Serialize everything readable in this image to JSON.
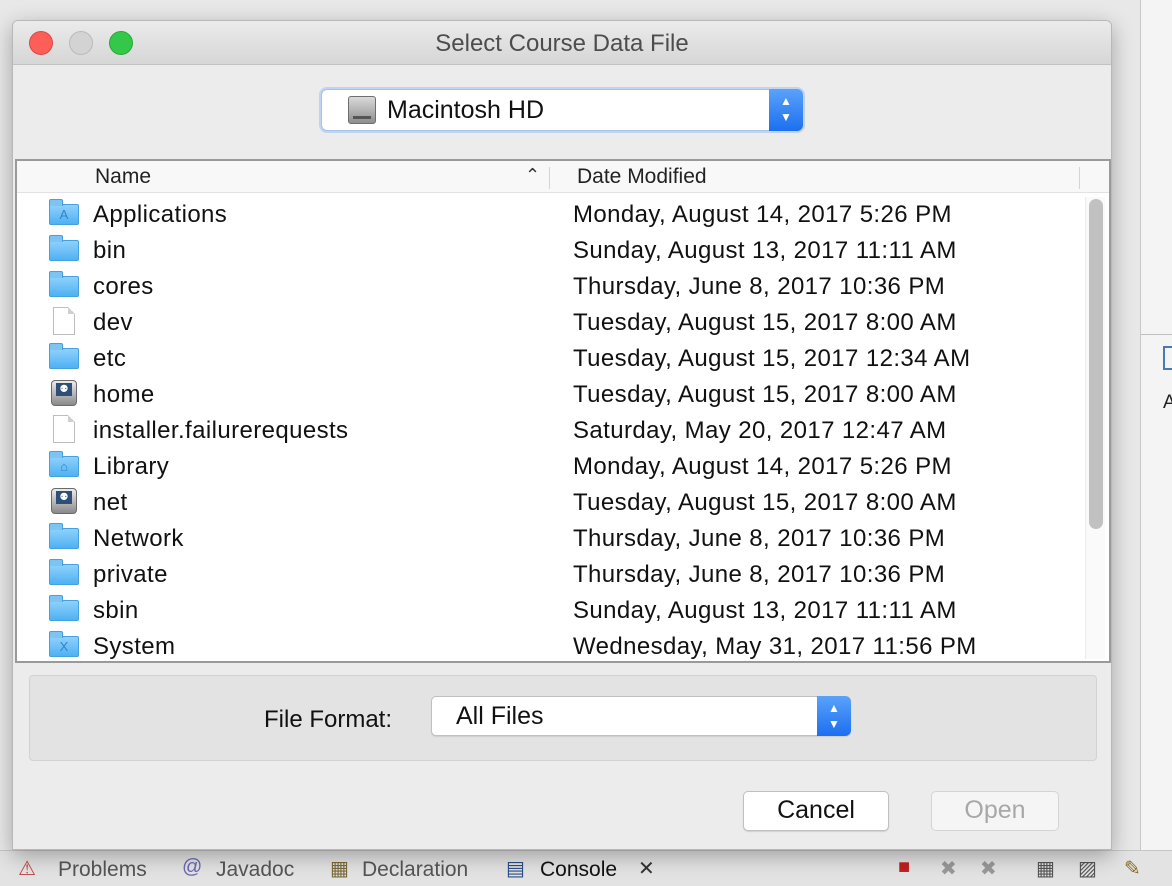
{
  "dialog": {
    "title": "Select Course Data File",
    "location": "Macintosh HD",
    "columns": {
      "name": "Name",
      "date": "Date Modified"
    },
    "files": [
      {
        "name": "Applications",
        "date": "Monday, August 14, 2017 5:26 PM",
        "icon": "applications-folder-icon"
      },
      {
        "name": "bin",
        "date": "Sunday, August 13, 2017 11:11 AM",
        "icon": "folder-icon"
      },
      {
        "name": "cores",
        "date": "Thursday, June 8, 2017 10:36 PM",
        "icon": "folder-icon"
      },
      {
        "name": "dev",
        "date": "Tuesday, August 15, 2017 8:00 AM",
        "icon": "document-icon"
      },
      {
        "name": "etc",
        "date": "Tuesday, August 15, 2017 12:34 AM",
        "icon": "folder-icon"
      },
      {
        "name": "home",
        "date": "Tuesday, August 15, 2017 8:00 AM",
        "icon": "server-icon"
      },
      {
        "name": "installer.failurerequests",
        "date": "Saturday, May 20, 2017 12:47 AM",
        "icon": "document-icon"
      },
      {
        "name": "Library",
        "date": "Monday, August 14, 2017 5:26 PM",
        "icon": "library-folder-icon"
      },
      {
        "name": "net",
        "date": "Tuesday, August 15, 2017 8:00 AM",
        "icon": "server-icon"
      },
      {
        "name": "Network",
        "date": "Thursday, June 8, 2017 10:36 PM",
        "icon": "folder-icon"
      },
      {
        "name": "private",
        "date": "Thursday, June 8, 2017 10:36 PM",
        "icon": "folder-icon"
      },
      {
        "name": "sbin",
        "date": "Sunday, August 13, 2017 11:11 AM",
        "icon": "folder-icon"
      },
      {
        "name": "System",
        "date": "Wednesday, May 31, 2017 11:56 PM",
        "icon": "system-folder-icon"
      }
    ],
    "format_label": "File Format:",
    "format_value": "All Files",
    "cancel_label": "Cancel",
    "open_label": "Open"
  },
  "ide": {
    "tabs": [
      "Problems",
      "Javadoc",
      "Declaration",
      "Console"
    ],
    "right_fragment": "A"
  },
  "colors": {
    "close": "#fc5f57",
    "minimize": "#d3d3d3",
    "zoom": "#34c84a",
    "accent": "#1c6ff0",
    "folder": "#5fb8f5"
  }
}
